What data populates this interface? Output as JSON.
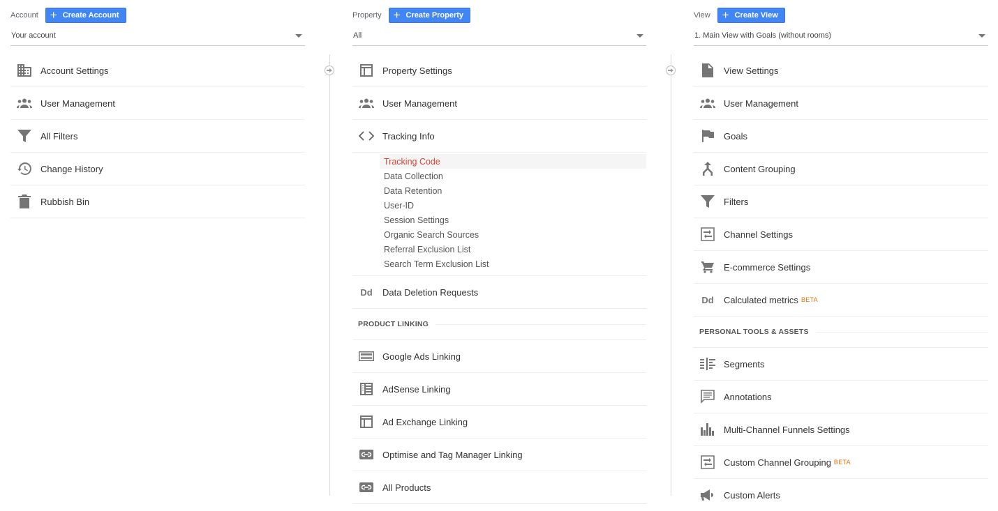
{
  "columns": {
    "account": {
      "header_label": "Account",
      "create_button": "Create Account",
      "selected": "Your account",
      "items": [
        {
          "label": "Account Settings",
          "icon": "building-icon"
        },
        {
          "label": "User Management",
          "icon": "people-icon"
        },
        {
          "label": "All Filters",
          "icon": "filter-icon"
        },
        {
          "label": "Change History",
          "icon": "history-icon"
        },
        {
          "label": "Rubbish Bin",
          "icon": "trash-icon"
        }
      ]
    },
    "property": {
      "header_label": "Property",
      "create_button": "Create Property",
      "selected": "All",
      "items": [
        {
          "label": "Property Settings",
          "icon": "layout-icon"
        },
        {
          "label": "User Management",
          "icon": "people-icon"
        },
        {
          "label": "Tracking Info",
          "icon": "code-icon"
        }
      ],
      "tracking_sub_items": [
        {
          "label": "Tracking Code",
          "active": true
        },
        {
          "label": "Data Collection"
        },
        {
          "label": "Data Retention"
        },
        {
          "label": "User-ID"
        },
        {
          "label": "Session Settings"
        },
        {
          "label": "Organic Search Sources"
        },
        {
          "label": "Referral Exclusion List"
        },
        {
          "label": "Search Term Exclusion List"
        }
      ],
      "data_deletion": {
        "label": "Data Deletion Requests",
        "icon": "dd-icon",
        "icon_text": "Dd"
      },
      "section_heading": "PRODUCT LINKING",
      "linking_items": [
        {
          "label": "Google Ads Linking",
          "icon": "ads-icon"
        },
        {
          "label": "AdSense Linking",
          "icon": "adsense-icon"
        },
        {
          "label": "Ad Exchange Linking",
          "icon": "layout-icon"
        },
        {
          "label": "Optimise and Tag Manager Linking",
          "icon": "link-icon"
        },
        {
          "label": "All Products",
          "icon": "link-icon"
        }
      ]
    },
    "view": {
      "header_label": "View",
      "create_button": "Create View",
      "selected": "1. Main View with Goals (without rooms)",
      "items": [
        {
          "label": "View Settings",
          "icon": "document-icon"
        },
        {
          "label": "User Management",
          "icon": "people-icon"
        },
        {
          "label": "Goals",
          "icon": "flag-icon"
        },
        {
          "label": "Content Grouping",
          "icon": "merge-icon"
        },
        {
          "label": "Filters",
          "icon": "filter-icon"
        },
        {
          "label": "Channel Settings",
          "icon": "channel-icon"
        },
        {
          "label": "E-commerce Settings",
          "icon": "cart-icon"
        },
        {
          "label": "Calculated metrics",
          "icon": "dd-icon",
          "icon_text": "Dd",
          "badge": "BETA"
        }
      ],
      "section_heading": "PERSONAL TOOLS & ASSETS",
      "personal_items": [
        {
          "label": "Segments",
          "icon": "segments-icon"
        },
        {
          "label": "Annotations",
          "icon": "comment-icon"
        },
        {
          "label": "Multi-Channel Funnels Settings",
          "icon": "bar-chart-icon"
        },
        {
          "label": "Custom Channel Grouping",
          "icon": "channel-icon",
          "badge": "BETA"
        },
        {
          "label": "Custom Alerts",
          "icon": "megaphone-icon"
        }
      ]
    }
  },
  "colors": {
    "accent": "#4285f4",
    "active_text": "#db4437",
    "beta": "#e8710a",
    "icon": "#757575"
  }
}
